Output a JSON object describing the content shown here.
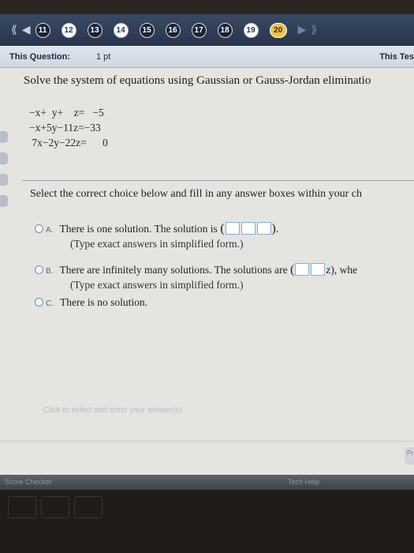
{
  "nav": {
    "first_icon": "double-chevron-left-icon",
    "prev_icon": "chevron-left-icon",
    "next_icon": "chevron-right-icon",
    "last_icon": "double-chevron-right-icon",
    "questions": [
      {
        "label": "11",
        "state": "pending"
      },
      {
        "label": "12",
        "state": "done"
      },
      {
        "label": "13",
        "state": "pending"
      },
      {
        "label": "14",
        "state": "done"
      },
      {
        "label": "15",
        "state": "pending"
      },
      {
        "label": "16",
        "state": "pending"
      },
      {
        "label": "17",
        "state": "pending"
      },
      {
        "label": "18",
        "state": "pending"
      },
      {
        "label": "19",
        "state": "done"
      },
      {
        "label": "20",
        "state": "current"
      }
    ]
  },
  "info": {
    "question_label": "This Question:",
    "points": "1 pt",
    "test_label": "This Tes"
  },
  "question": {
    "instruction": "Solve the system of equations using Gaussian or Gauss-Jordan eliminatio",
    "equations": [
      "−x+  y+    z=   −5",
      "−x+5y−11z=−33",
      " 7x−2y−22z=      0"
    ],
    "select_text": "Select the correct choice below and fill in any answer boxes within your ch"
  },
  "choices": {
    "a": {
      "letter": "A.",
      "text_before": "There is one solution. The solution is",
      "text_after": ".",
      "hint": "(Type exact answers in simplified form.)"
    },
    "b": {
      "letter": "B.",
      "text_before": "There are infinitely many solutions. The solutions are",
      "text_after": "z), whe",
      "hint": "(Type exact answers in simplified form.)"
    },
    "c": {
      "letter": "C.",
      "text": "There is no solution."
    }
  },
  "footer": {
    "hint": "Click to select and enter your answer(s).",
    "right_button": "Pr"
  },
  "bottombar": {
    "left": "Score Checker",
    "right": "Tech Help"
  }
}
